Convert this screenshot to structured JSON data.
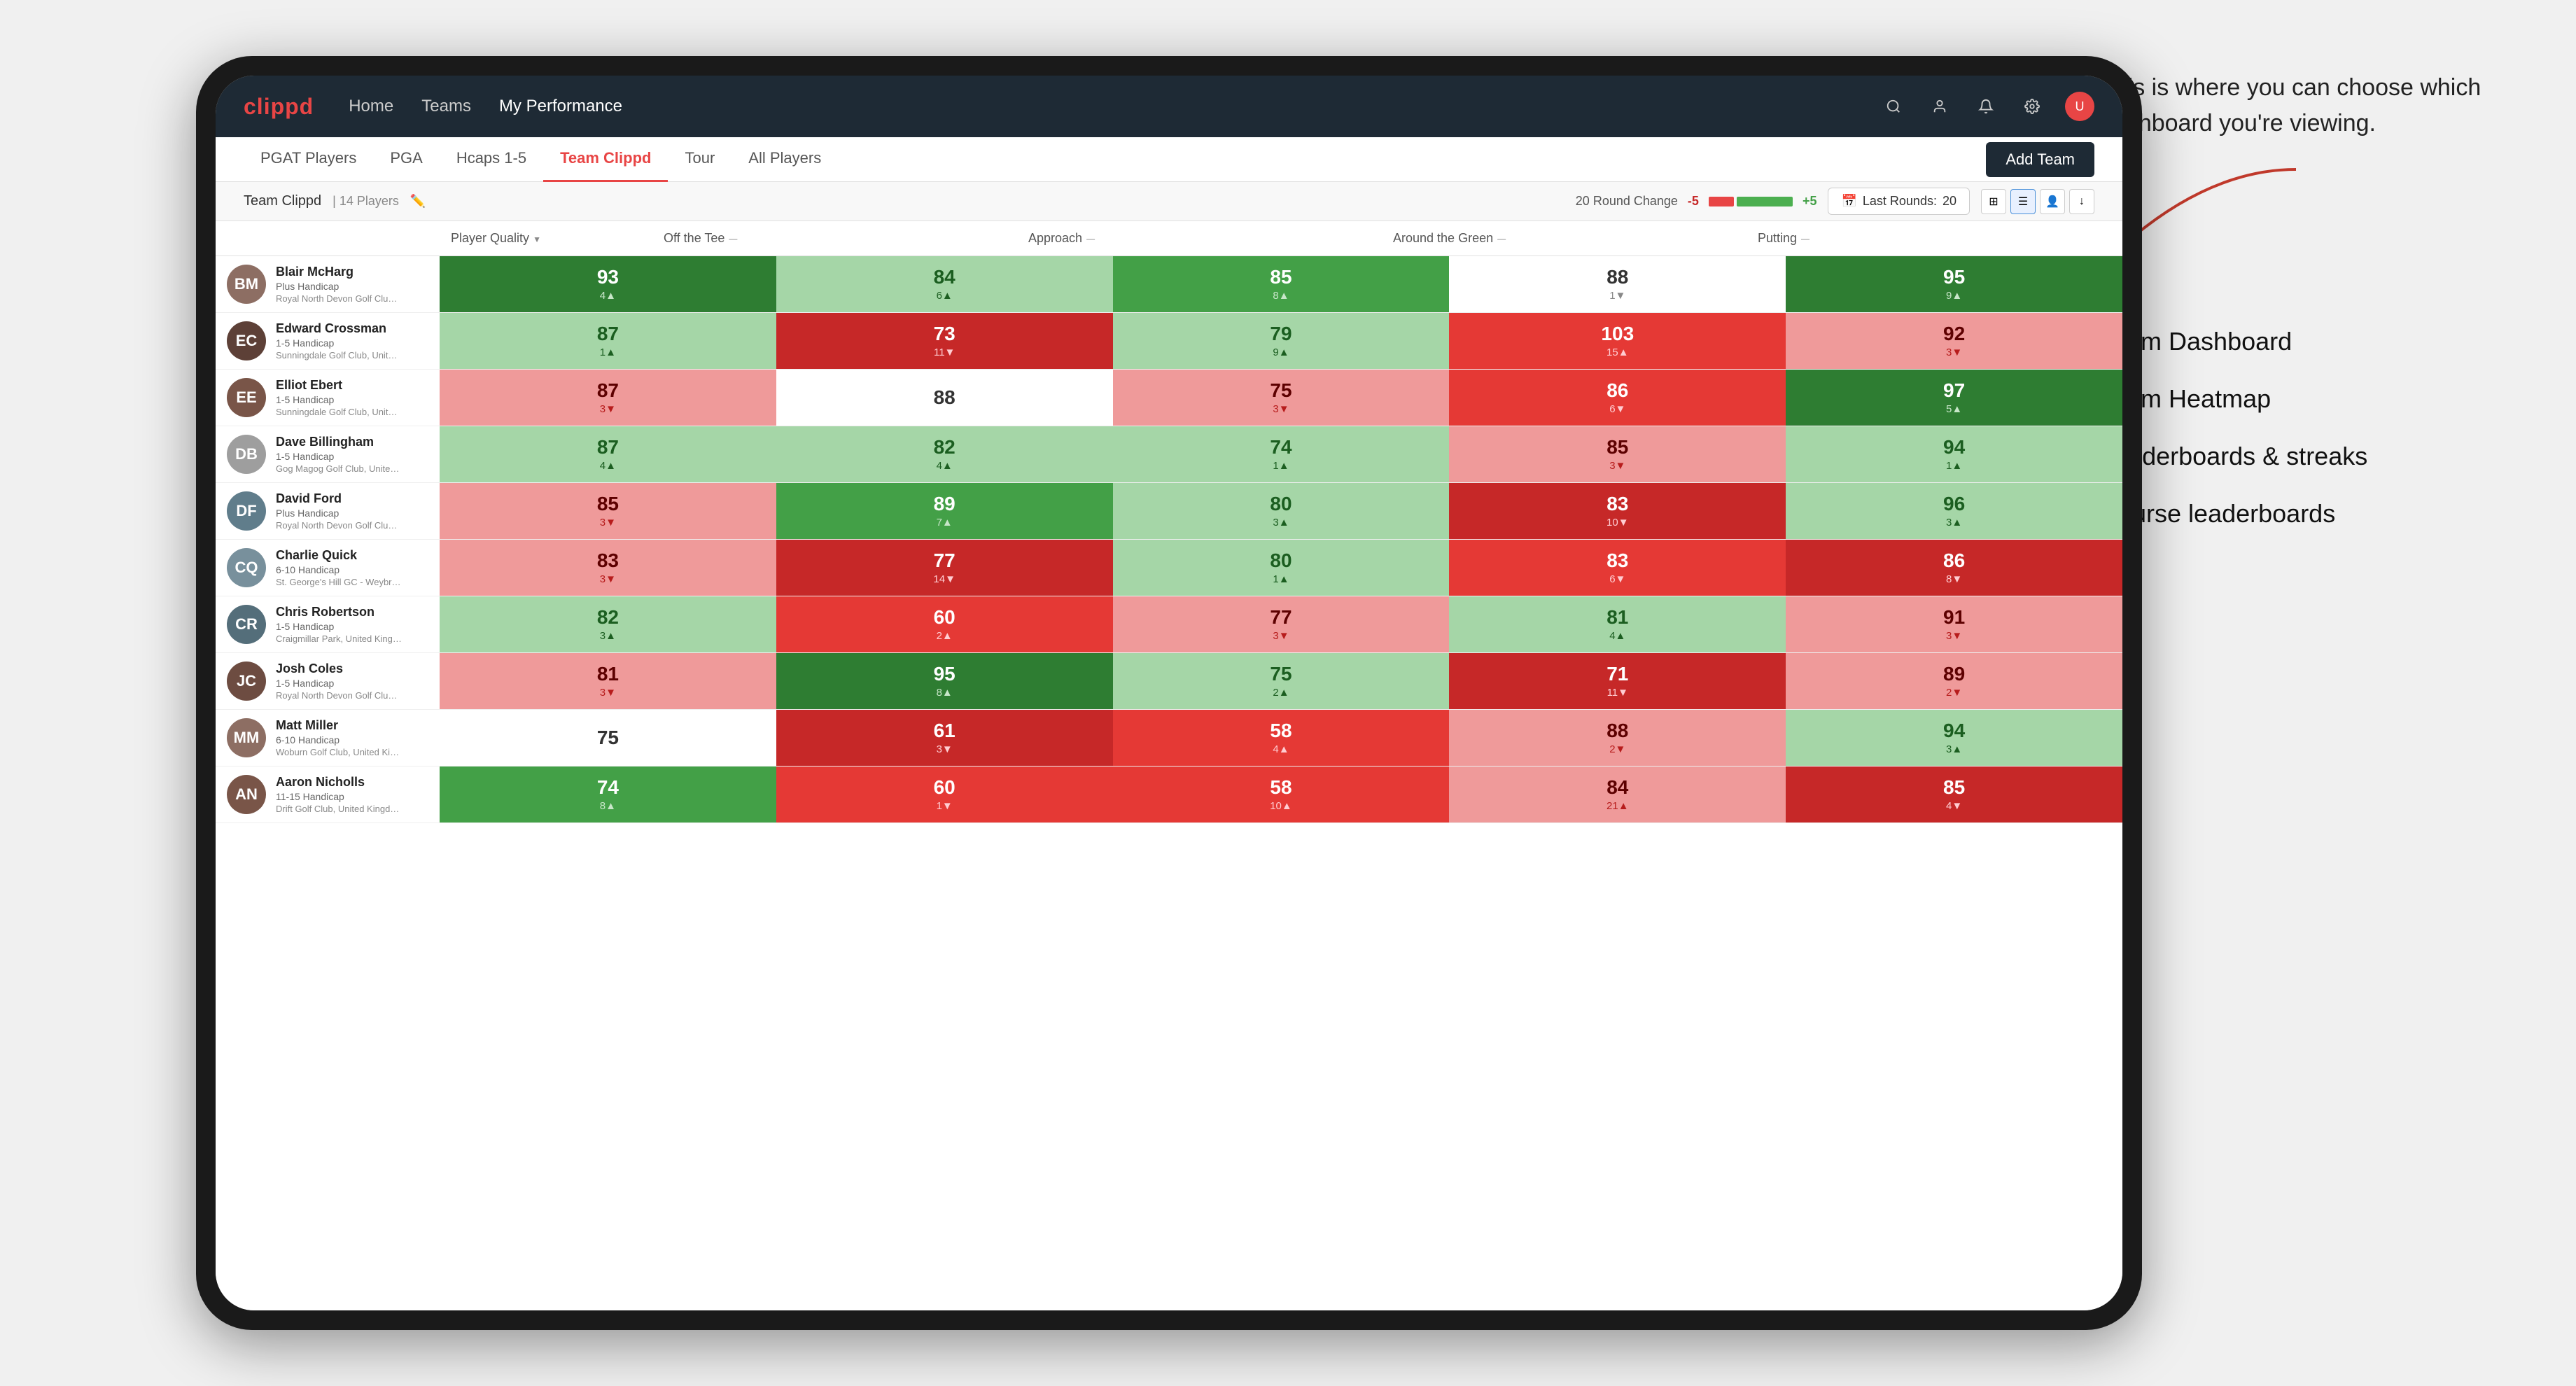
{
  "annotation": {
    "tooltip": "This is where you can choose which dashboard you're viewing.",
    "menu_items": [
      "Team Dashboard",
      "Team Heatmap",
      "Leaderboards & streaks",
      "Course leaderboards"
    ]
  },
  "navbar": {
    "logo": "clippd",
    "items": [
      "Home",
      "Teams",
      "My Performance"
    ],
    "active_item": "My Performance"
  },
  "subnav": {
    "items": [
      "PGAT Players",
      "PGA",
      "Hcaps 1-5",
      "Team Clippd",
      "Tour",
      "All Players"
    ],
    "active_item": "Team Clippd",
    "add_team_label": "Add Team"
  },
  "team_header": {
    "name": "Team Clippd",
    "separator": "|",
    "count": "14 Players",
    "round_change_label": "20 Round Change",
    "change_minus": "-5",
    "change_plus": "+5",
    "last_rounds_label": "Last Rounds:",
    "last_rounds_value": "20"
  },
  "columns": [
    {
      "label": "Player Quality",
      "sort": "▼"
    },
    {
      "label": "Off the Tee",
      "sort": "—"
    },
    {
      "label": "Approach",
      "sort": "—"
    },
    {
      "label": "Around the Green",
      "sort": "—"
    },
    {
      "label": "Putting",
      "sort": "—"
    }
  ],
  "players": [
    {
      "name": "Blair McHarg",
      "hcap": "Plus Handicap",
      "club": "Royal North Devon Golf Club, United Kingdom",
      "avatar_color": "#8D6E63",
      "avatar_initials": "BM",
      "stats": [
        {
          "value": "93",
          "change": "4▲",
          "dir": "up",
          "bg": "green-dark"
        },
        {
          "value": "84",
          "change": "6▲",
          "dir": "up",
          "bg": "green-light"
        },
        {
          "value": "85",
          "change": "8▲",
          "dir": "up",
          "bg": "green-mid"
        },
        {
          "value": "88",
          "change": "1▼",
          "dir": "down",
          "bg": "white"
        },
        {
          "value": "95",
          "change": "9▲",
          "dir": "up",
          "bg": "green-dark"
        }
      ]
    },
    {
      "name": "Edward Crossman",
      "hcap": "1-5 Handicap",
      "club": "Sunningdale Golf Club, United Kingdom",
      "avatar_color": "#5D4037",
      "avatar_initials": "EC",
      "stats": [
        {
          "value": "87",
          "change": "1▲",
          "dir": "up",
          "bg": "green-light"
        },
        {
          "value": "73",
          "change": "11▼",
          "dir": "down",
          "bg": "red-dark"
        },
        {
          "value": "79",
          "change": "9▲",
          "dir": "up",
          "bg": "green-light"
        },
        {
          "value": "103",
          "change": "15▲",
          "dir": "up",
          "bg": "red-mid"
        },
        {
          "value": "92",
          "change": "3▼",
          "dir": "down",
          "bg": "red-light"
        }
      ]
    },
    {
      "name": "Elliot Ebert",
      "hcap": "1-5 Handicap",
      "club": "Sunningdale Golf Club, United Kingdom",
      "avatar_color": "#795548",
      "avatar_initials": "EE",
      "stats": [
        {
          "value": "87",
          "change": "3▼",
          "dir": "down",
          "bg": "red-light"
        },
        {
          "value": "88",
          "change": "",
          "dir": "neutral",
          "bg": "white"
        },
        {
          "value": "75",
          "change": "3▼",
          "dir": "down",
          "bg": "red-light"
        },
        {
          "value": "86",
          "change": "6▼",
          "dir": "down",
          "bg": "red-mid"
        },
        {
          "value": "97",
          "change": "5▲",
          "dir": "up",
          "bg": "green-dark"
        }
      ]
    },
    {
      "name": "Dave Billingham",
      "hcap": "1-5 Handicap",
      "club": "Gog Magog Golf Club, United Kingdom",
      "avatar_color": "#9E9E9E",
      "avatar_initials": "DB",
      "stats": [
        {
          "value": "87",
          "change": "4▲",
          "dir": "up",
          "bg": "green-light"
        },
        {
          "value": "82",
          "change": "4▲",
          "dir": "up",
          "bg": "green-light"
        },
        {
          "value": "74",
          "change": "1▲",
          "dir": "up",
          "bg": "green-light"
        },
        {
          "value": "85",
          "change": "3▼",
          "dir": "down",
          "bg": "red-light"
        },
        {
          "value": "94",
          "change": "1▲",
          "dir": "up",
          "bg": "green-light"
        }
      ]
    },
    {
      "name": "David Ford",
      "hcap": "Plus Handicap",
      "club": "Royal North Devon Golf Club, United Kingdom",
      "avatar_color": "#607D8B",
      "avatar_initials": "DF",
      "stats": [
        {
          "value": "85",
          "change": "3▼",
          "dir": "down",
          "bg": "red-light"
        },
        {
          "value": "89",
          "change": "7▲",
          "dir": "up",
          "bg": "green-mid"
        },
        {
          "value": "80",
          "change": "3▲",
          "dir": "up",
          "bg": "green-light"
        },
        {
          "value": "83",
          "change": "10▼",
          "dir": "down",
          "bg": "red-dark"
        },
        {
          "value": "96",
          "change": "3▲",
          "dir": "up",
          "bg": "green-light"
        }
      ]
    },
    {
      "name": "Charlie Quick",
      "hcap": "6-10 Handicap",
      "club": "St. George's Hill GC - Weybridge - Surrey, United Kingdom",
      "avatar_color": "#78909C",
      "avatar_initials": "CQ",
      "stats": [
        {
          "value": "83",
          "change": "3▼",
          "dir": "down",
          "bg": "red-light"
        },
        {
          "value": "77",
          "change": "14▼",
          "dir": "down",
          "bg": "red-dark"
        },
        {
          "value": "80",
          "change": "1▲",
          "dir": "up",
          "bg": "green-light"
        },
        {
          "value": "83",
          "change": "6▼",
          "dir": "down",
          "bg": "red-mid"
        },
        {
          "value": "86",
          "change": "8▼",
          "dir": "down",
          "bg": "red-dark"
        }
      ]
    },
    {
      "name": "Chris Robertson",
      "hcap": "1-5 Handicap",
      "club": "Craigmillar Park, United Kingdom",
      "avatar_color": "#546E7A",
      "avatar_initials": "CR",
      "stats": [
        {
          "value": "82",
          "change": "3▲",
          "dir": "up",
          "bg": "green-light"
        },
        {
          "value": "60",
          "change": "2▲",
          "dir": "up",
          "bg": "red-mid"
        },
        {
          "value": "77",
          "change": "3▼",
          "dir": "down",
          "bg": "red-light"
        },
        {
          "value": "81",
          "change": "4▲",
          "dir": "up",
          "bg": "green-light"
        },
        {
          "value": "91",
          "change": "3▼",
          "dir": "down",
          "bg": "red-light"
        }
      ]
    },
    {
      "name": "Josh Coles",
      "hcap": "1-5 Handicap",
      "club": "Royal North Devon Golf Club, United Kingdom",
      "avatar_color": "#6D4C41",
      "avatar_initials": "JC",
      "stats": [
        {
          "value": "81",
          "change": "3▼",
          "dir": "down",
          "bg": "red-light"
        },
        {
          "value": "95",
          "change": "8▲",
          "dir": "up",
          "bg": "green-dark"
        },
        {
          "value": "75",
          "change": "2▲",
          "dir": "up",
          "bg": "green-light"
        },
        {
          "value": "71",
          "change": "11▼",
          "dir": "down",
          "bg": "red-dark"
        },
        {
          "value": "89",
          "change": "2▼",
          "dir": "down",
          "bg": "red-light"
        }
      ]
    },
    {
      "name": "Matt Miller",
      "hcap": "6-10 Handicap",
      "club": "Woburn Golf Club, United Kingdom",
      "avatar_color": "#8D6E63",
      "avatar_initials": "MM",
      "stats": [
        {
          "value": "75",
          "change": "",
          "dir": "neutral",
          "bg": "white"
        },
        {
          "value": "61",
          "change": "3▼",
          "dir": "down",
          "bg": "red-dark"
        },
        {
          "value": "58",
          "change": "4▲",
          "dir": "up",
          "bg": "red-mid"
        },
        {
          "value": "88",
          "change": "2▼",
          "dir": "down",
          "bg": "red-light"
        },
        {
          "value": "94",
          "change": "3▲",
          "dir": "up",
          "bg": "green-light"
        }
      ]
    },
    {
      "name": "Aaron Nicholls",
      "hcap": "11-15 Handicap",
      "club": "Drift Golf Club, United Kingdom",
      "avatar_color": "#795548",
      "avatar_initials": "AN",
      "stats": [
        {
          "value": "74",
          "change": "8▲",
          "dir": "up",
          "bg": "green-mid"
        },
        {
          "value": "60",
          "change": "1▼",
          "dir": "down",
          "bg": "red-mid"
        },
        {
          "value": "58",
          "change": "10▲",
          "dir": "up",
          "bg": "red-mid"
        },
        {
          "value": "84",
          "change": "21▲",
          "dir": "up",
          "bg": "red-light"
        },
        {
          "value": "85",
          "change": "4▼",
          "dir": "down",
          "bg": "red-dark"
        }
      ]
    }
  ],
  "colors": {
    "navbar_bg": "#1e2a35",
    "brand_red": "#e84545",
    "green_dark": "#2e7d32",
    "green_mid": "#43a047",
    "green_light": "#a5d6a7",
    "red_dark": "#c62828",
    "red_mid": "#e53935",
    "red_light": "#ef9a9a",
    "white_bg": "#ffffff"
  }
}
